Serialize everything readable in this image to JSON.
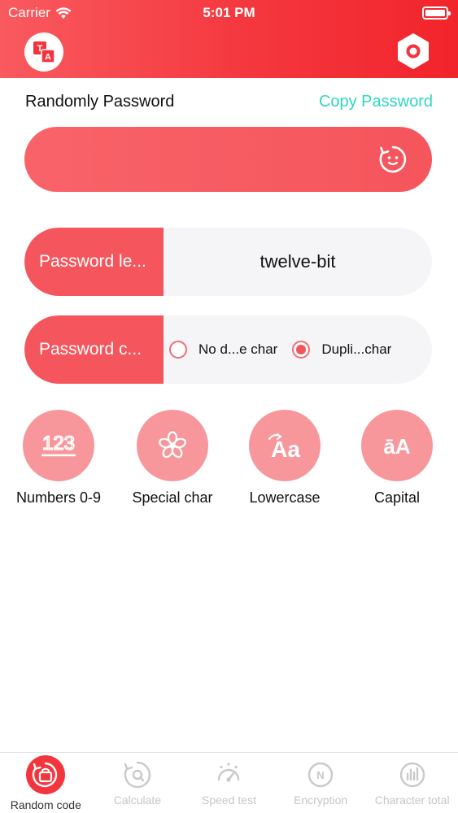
{
  "status_bar": {
    "carrier": "Carrier",
    "time": "5:01 PM"
  },
  "header": {
    "translate_icon": "translate-icon",
    "settings_icon": "hexagon-settings-icon"
  },
  "password": {
    "section_label": "Randomly Password",
    "copy_label": "Copy Password",
    "value": "",
    "refresh_icon": "refresh-face-icon"
  },
  "length_option": {
    "label": "Password le...",
    "value": "twelve-bit"
  },
  "chars_option": {
    "label": "Password c...",
    "options": [
      {
        "label": "No d...e char",
        "checked": false
      },
      {
        "label": "Dupli...char",
        "checked": true
      }
    ]
  },
  "char_types": [
    {
      "label": "Numbers 0-9",
      "icon": "numbers-icon",
      "glyph": "123"
    },
    {
      "label": "Special char",
      "icon": "flower-icon",
      "glyph": ""
    },
    {
      "label": "Lowercase",
      "icon": "lowercase-icon",
      "glyph": "Aa"
    },
    {
      "label": "Capital",
      "icon": "capital-icon",
      "glyph": "āA"
    }
  ],
  "tabs": [
    {
      "label": "Random code",
      "icon": "random-code-icon",
      "active": true
    },
    {
      "label": "Calculate",
      "icon": "calculate-icon",
      "active": false
    },
    {
      "label": "Speed test",
      "icon": "speed-test-icon",
      "active": false
    },
    {
      "label": "Encryption",
      "icon": "encryption-icon",
      "active": false
    },
    {
      "label": "Character total",
      "icon": "character-total-icon",
      "active": false
    }
  ],
  "colors": {
    "primary": "#f5555c",
    "primary_light": "#f7979c",
    "accent_teal": "#2fd8c0",
    "inactive": "#c6c6c6"
  }
}
